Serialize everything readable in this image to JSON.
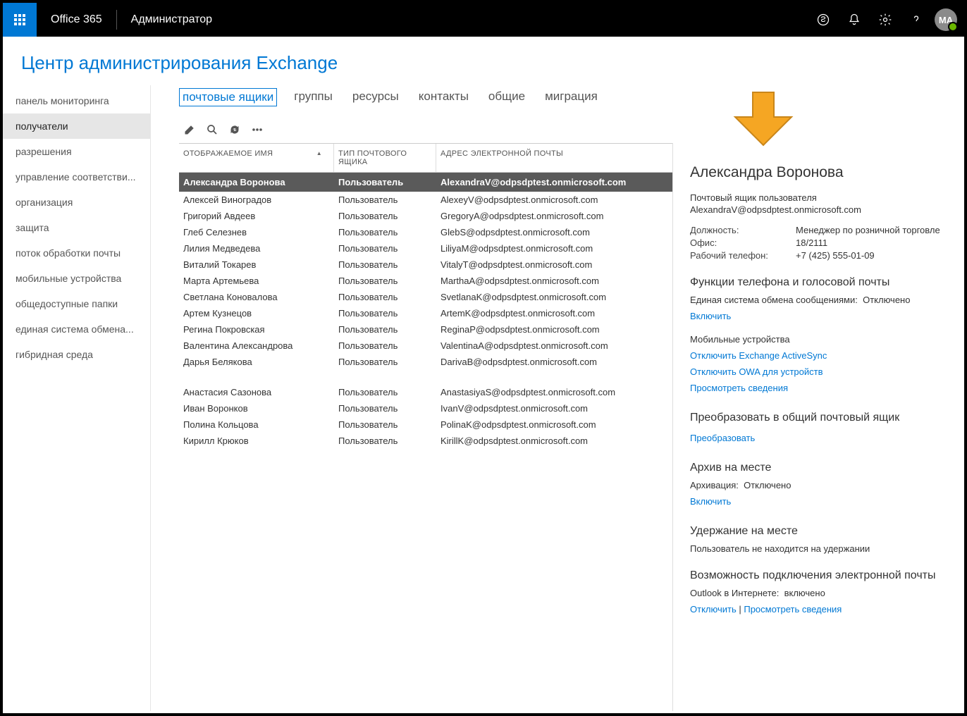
{
  "topbar": {
    "brand": "Office 365",
    "role": "Администратор",
    "avatar": "MA"
  },
  "page_title": "Центр администрирования Exchange",
  "sidebar": {
    "items": [
      {
        "label": "панель мониторинга",
        "active": false
      },
      {
        "label": "получатели",
        "active": true
      },
      {
        "label": "разрешения",
        "active": false
      },
      {
        "label": "управление соответстви...",
        "active": false
      },
      {
        "label": "организация",
        "active": false
      },
      {
        "label": "защита",
        "active": false
      },
      {
        "label": "поток обработки почты",
        "active": false
      },
      {
        "label": "мобильные устройства",
        "active": false
      },
      {
        "label": "общедоступные папки",
        "active": false
      },
      {
        "label": "единая система обмена...",
        "active": false
      },
      {
        "label": "гибридная среда",
        "active": false
      }
    ]
  },
  "tabs": [
    {
      "label": "почтовые ящики",
      "active": true
    },
    {
      "label": "группы",
      "active": false
    },
    {
      "label": "ресурсы",
      "active": false
    },
    {
      "label": "контакты",
      "active": false
    },
    {
      "label": "общие",
      "active": false
    },
    {
      "label": "миграция",
      "active": false
    }
  ],
  "columns": {
    "name": "ОТОБРАЖАЕМОЕ ИМЯ",
    "type": "ТИП ПОЧТОВОГО ЯЩИКА",
    "email": "АДРЕС ЭЛЕКТРОННОЙ ПОЧТЫ"
  },
  "rows": [
    {
      "name": "Александра Воронова",
      "type": "Пользователь",
      "email": "AlexandraV@odpsdptest.onmicrosoft.com",
      "selected": true
    },
    {
      "name": "Алексей Виноградов",
      "type": "Пользователь",
      "email": "AlexeyV@odpsdptest.onmicrosoft.com"
    },
    {
      "name": "Григорий Авдеев",
      "type": "Пользователь",
      "email": "GregoryA@odpsdptest.onmicrosoft.com"
    },
    {
      "name": "Глеб Селезнев",
      "type": "Пользователь",
      "email": "GlebS@odpsdptest.onmicrosoft.com"
    },
    {
      "name": "Лилия Медведева",
      "type": "Пользователь",
      "email": "LiliyaM@odpsdptest.onmicrosoft.com"
    },
    {
      "name": "Виталий Токарев",
      "type": "Пользователь",
      "email": "VitalyT@odpsdptest.onmicrosoft.com"
    },
    {
      "name": "Марта Артемьева",
      "type": "Пользователь",
      "email": "MarthaA@odpsdptest.onmicrosoft.com"
    },
    {
      "name": "Светлана Коновалова",
      "type": "Пользователь",
      "email": "SvetlanaK@odpsdptest.onmicrosoft.com"
    },
    {
      "name": "Артем Кузнецов",
      "type": "Пользователь",
      "email": "ArtemK@odpsdptest.onmicrosoft.com"
    },
    {
      "name": "Регина Покровская",
      "type": "Пользователь",
      "email": "ReginaP@odpsdptest.onmicrosoft.com"
    },
    {
      "name": "Валентина Александрова",
      "type": "Пользователь",
      "email": "ValentinaA@odpsdptest.onmicrosoft.com"
    },
    {
      "name": "Дарья Белякова",
      "type": "Пользователь",
      "email": "DarivaB@odpsdptest.onmicrosoft.com"
    },
    {
      "gap": true
    },
    {
      "name": "Анастасия Сазонова",
      "type": "Пользователь",
      "email": "AnastasiyaS@odpsdptest.onmicrosoft.com"
    },
    {
      "name": "Иван Воронков",
      "type": "Пользователь",
      "email": "IvanV@odpsdptest.onmicrosoft.com"
    },
    {
      "name": "Полина Кольцова",
      "type": "Пользователь",
      "email": "PolinaK@odpsdptest.onmicrosoft.com"
    },
    {
      "name": "Кирилл Крюков",
      "type": "Пользователь",
      "email": "KirillK@odpsdptest.onmicrosoft.com"
    }
  ],
  "details": {
    "name": "Александра Воронова",
    "mailbox_type": "Почтовый ящик пользователя",
    "email": "AlexandraV@odpsdptest.onmicrosoft.com",
    "title_label": "Должность:",
    "title_value": "Менеджер по розничной торговле",
    "office_label": "Офис:",
    "office_value": "18/2111",
    "phone_label": "Рабочий телефон:",
    "phone_value": "+7 (425) 555-01-09",
    "phone_features_h": "Функции телефона и голосовой почты",
    "um_label": "Единая система обмена сообщениями:",
    "um_value": "Отключено",
    "um_enable": "Включить",
    "mobile_h": "Мобильные устройства",
    "disable_eas": "Отключить Exchange ActiveSync",
    "disable_owa": "Отключить OWA для устройств",
    "view_details": "Просмотреть сведения",
    "convert_h": "Преобразовать в общий почтовый ящик",
    "convert_link": "Преобразовать",
    "archive_h": "Архив на месте",
    "archive_label": "Архивация:",
    "archive_value": "Отключено",
    "archive_enable": "Включить",
    "hold_h": "Удержание на месте",
    "hold_status": "Пользователь не находится на удержании",
    "conn_h": "Возможность подключения электронной почты",
    "owa_label": "Outlook в Интернете:",
    "owa_value": "включено",
    "owa_disable": "Отключить",
    "owa_sep": " | ",
    "owa_view": "Просмотреть сведения"
  }
}
